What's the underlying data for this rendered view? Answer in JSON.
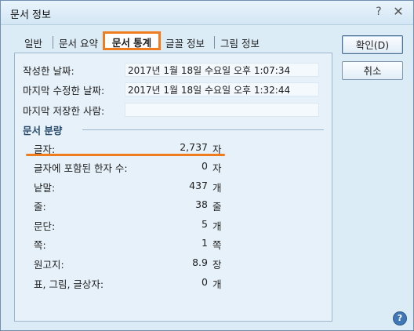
{
  "window": {
    "title": "문서 정보",
    "help_glyph": "?",
    "close_glyph": "✕"
  },
  "tabs": [
    {
      "label": "일반"
    },
    {
      "label": "문서 요약"
    },
    {
      "label": "문서 통계",
      "selected": true
    },
    {
      "label": "글꼴 정보"
    },
    {
      "label": "그림 정보"
    }
  ],
  "buttons": {
    "ok": "확인(D)",
    "cancel": "취소"
  },
  "info": {
    "created_label": "작성한 날짜:",
    "created_value": "2017년 1월 18일 수요일 오후 1:07:34",
    "modified_label": "마지막 수정한 날짜:",
    "modified_value": "2017년 1월 18일 수요일 오후 1:32:44",
    "saved_by_label": "마지막 저장한 사람:",
    "saved_by_value": ""
  },
  "group": {
    "title": "문서 분량"
  },
  "stats": [
    {
      "label": "글자:",
      "value": "2,737",
      "unit": "자"
    },
    {
      "label": "글자에 포함된 한자 수:",
      "value": "0",
      "unit": "자"
    },
    {
      "label": "낱말:",
      "value": "437",
      "unit": "개"
    },
    {
      "label": "줄:",
      "value": "38",
      "unit": "줄"
    },
    {
      "label": "문단:",
      "value": "5",
      "unit": "개"
    },
    {
      "label": "쪽:",
      "value": "1",
      "unit": "쪽"
    },
    {
      "label": "원고지:",
      "value": "8.9",
      "unit": "장"
    },
    {
      "label": "표, 그림, 글상자:",
      "value": "0",
      "unit": "개"
    }
  ],
  "colors": {
    "highlight": "#f07c1e",
    "background": "#dcecf7"
  },
  "icons": {
    "bottom_right": "help-icon"
  }
}
